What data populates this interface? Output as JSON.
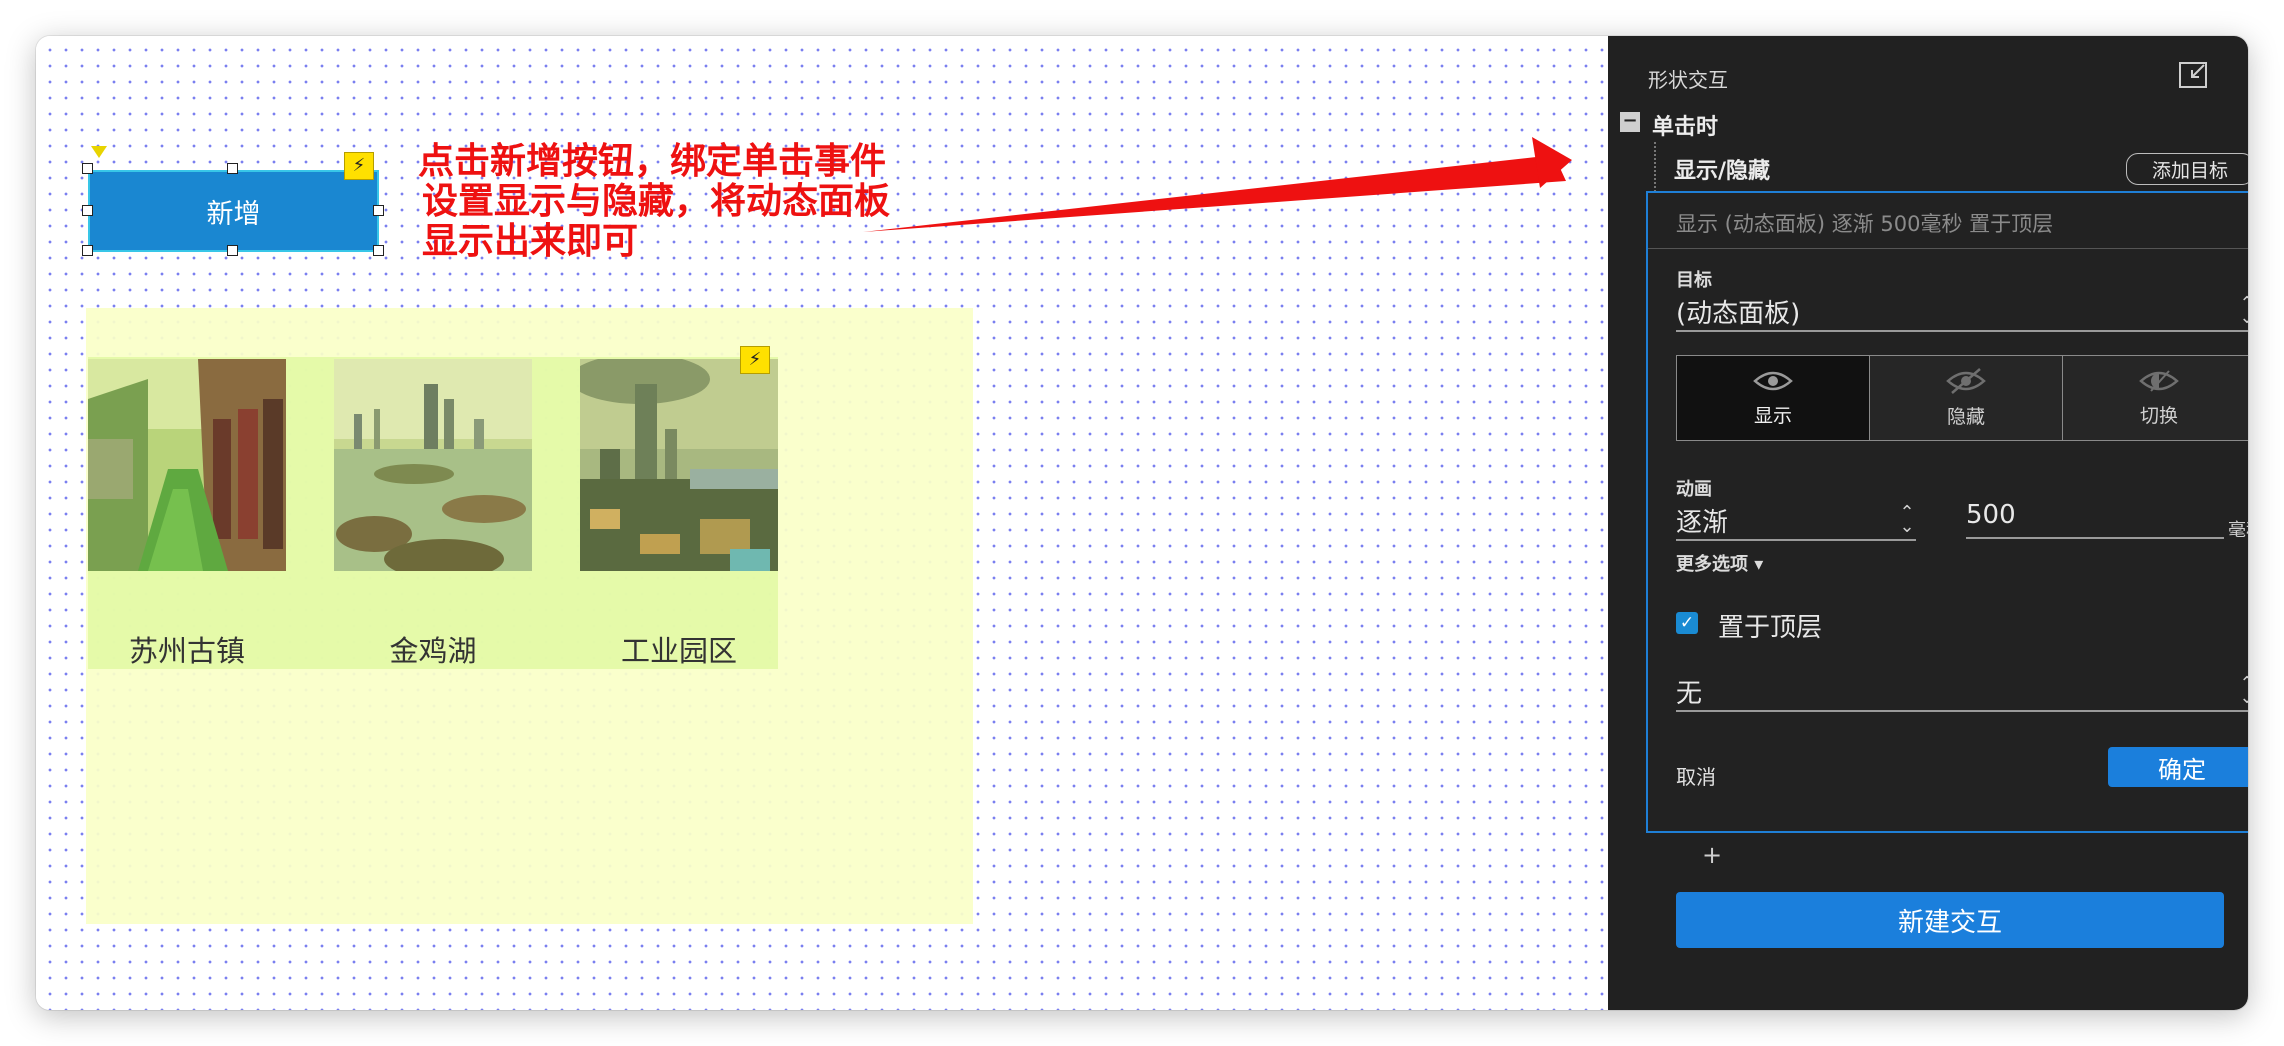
{
  "canvas": {
    "add_button_label": "新增",
    "annotation_lines": [
      "点击新增按钮，绑定单击事件",
      "设置显示与隐藏，将动态面板",
      "显示出来即可"
    ],
    "gallery": [
      {
        "caption": "苏州古镇",
        "image": "canal-town-photo"
      },
      {
        "caption": "金鸡湖",
        "image": "lake-skyline-photo"
      },
      {
        "caption": "工业园区",
        "image": "city-aerial-photo"
      }
    ]
  },
  "panel": {
    "title": "形状交互",
    "event_label": "单击时",
    "action_label": "显示/隐藏",
    "add_target_label": "添加目标",
    "summary": "显示 (动态面板) 逐渐 500毫秒 置于顶层",
    "target_label": "目标",
    "target_value": "(动态面板)",
    "modes": [
      {
        "label": "显示",
        "icon": "eye-icon",
        "active": true
      },
      {
        "label": "隐藏",
        "icon": "eye-off-icon",
        "active": false
      },
      {
        "label": "切换",
        "icon": "eye-toggle-icon",
        "active": false
      }
    ],
    "animation_label": "动画",
    "animation_value": "逐渐",
    "duration_value": "500",
    "duration_unit": "毫秒",
    "more_options_label": "更多选项 ▾",
    "bring_to_front_label": "置于顶层",
    "bring_to_front_checked": true,
    "light_box_value": "无",
    "cancel_label": "取消",
    "ok_label": "确定",
    "add_symbol": "+",
    "new_interaction_label": "新建交互"
  },
  "colors": {
    "accent": "#1b7fdc",
    "annotation": "#ee1111",
    "dynamic_panel_fill": "#fafcc8"
  }
}
